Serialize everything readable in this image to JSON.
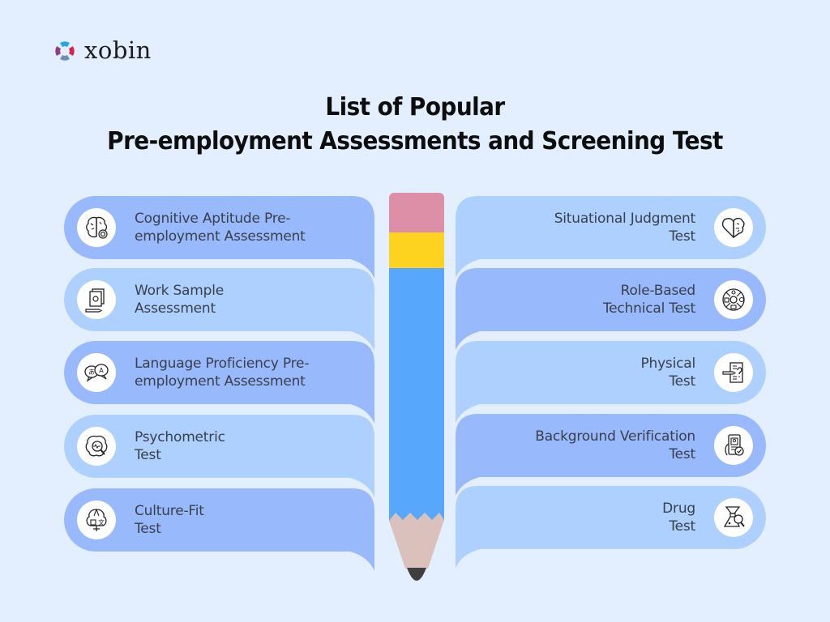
{
  "brand": {
    "name": "xobin"
  },
  "title": {
    "line1": "List of Popular",
    "line2": "Pre-employment Assessments and Screening Test"
  },
  "colors": {
    "background": "#e3effe",
    "card_dark": "#99b9fd",
    "card_light": "#aed0fe",
    "pencil_eraser": "#dd8fa8",
    "pencil_band": "#fdd31f",
    "pencil_body": "#57a8fd",
    "pencil_wood": "#dbc1bb",
    "pencil_lead": "#3f3f3f"
  },
  "left_items": [
    {
      "line1": "Cognitive Aptitude Pre-",
      "line2": "employment Assessment",
      "icon": "brain-target-icon"
    },
    {
      "line1": "Work Sample",
      "line2": "Assessment",
      "icon": "documents-pencil-icon"
    },
    {
      "line1": "Language Proficiency Pre-",
      "line2": "employment Assessment",
      "icon": "translation-bubbles-icon"
    },
    {
      "line1": "Psychometric",
      "line2": "Test",
      "icon": "brain-magnifier-icon"
    },
    {
      "line1": "Culture-Fit",
      "line2": "Test",
      "icon": "culture-tree-icon"
    }
  ],
  "right_items": [
    {
      "line1": "Situational Judgment",
      "line2": "Test",
      "icon": "heart-brain-icon"
    },
    {
      "line1": "Role-Based",
      "line2": "Technical Test",
      "icon": "skills-wheel-icon"
    },
    {
      "line1": "Physical",
      "line2": "Test",
      "icon": "questionnaire-pencil-icon"
    },
    {
      "line1": "Background Verification",
      "line2": "Test",
      "icon": "id-card-check-icon"
    },
    {
      "line1": "Drug",
      "line2": "Test",
      "icon": "lab-flask-magnifier-icon"
    }
  ]
}
